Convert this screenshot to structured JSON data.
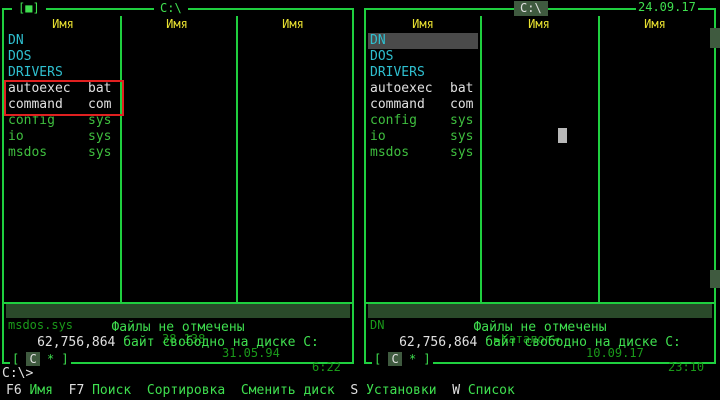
{
  "left_panel": {
    "title": "C:\\",
    "marker": "[■]",
    "col_headers": [
      "Имя",
      "Имя",
      "Имя"
    ],
    "files": [
      {
        "name": "DN",
        "ext": "",
        "kind": "dir"
      },
      {
        "name": "DOS",
        "ext": "",
        "kind": "dir"
      },
      {
        "name": "DRIVERS",
        "ext": "",
        "kind": "dir"
      },
      {
        "name": "autoexec",
        "ext": "bat",
        "kind": "exec"
      },
      {
        "name": "command",
        "ext": "com",
        "kind": "exec"
      },
      {
        "name": "config",
        "ext": "sys",
        "kind": "file"
      },
      {
        "name": "io",
        "ext": "sys",
        "kind": "file"
      },
      {
        "name": "msdos",
        "ext": "sys",
        "kind": "file"
      }
    ],
    "info_name": "msdos.sys",
    "info_size": "38,138",
    "info_date": "31.05.94",
    "info_time": "6:22",
    "status": "Файлы не отмечены",
    "free_bytes": "62,756,864",
    "free_label": "байт свободно на диске C:",
    "drive_prefix": "[",
    "drive_letter": "C",
    "drive_suffix": "* ]"
  },
  "right_panel": {
    "title": "C:\\",
    "clock_date": "24.09.17",
    "col_headers": [
      "Имя",
      "Имя",
      "Имя"
    ],
    "files": [
      {
        "name": "DN",
        "ext": "",
        "kind": "dir"
      },
      {
        "name": "DOS",
        "ext": "",
        "kind": "dir"
      },
      {
        "name": "DRIVERS",
        "ext": "",
        "kind": "dir"
      },
      {
        "name": "autoexec",
        "ext": "bat",
        "kind": "exec"
      },
      {
        "name": "command",
        "ext": "com",
        "kind": "exec"
      },
      {
        "name": "config",
        "ext": "sys",
        "kind": "file"
      },
      {
        "name": "io",
        "ext": "sys",
        "kind": "file"
      },
      {
        "name": "msdos",
        "ext": "sys",
        "kind": "file"
      }
    ],
    "info_name": "DN",
    "info_size": "►Каталог◄",
    "info_date": "10.09.17",
    "info_time": "23:10",
    "status": "Файлы не отмечены",
    "free_bytes": "62,756,864",
    "free_label": "байт свободно на диске C:",
    "drive_prefix": "[",
    "drive_letter": "C",
    "drive_suffix": "* ]"
  },
  "command_line": {
    "prompt": "C:\\>"
  },
  "keybar": [
    {
      "key": "F6",
      "label": "Имя"
    },
    {
      "key": "F7",
      "label": "Поиск"
    },
    {
      "key": "",
      "label": "Сортировка"
    },
    {
      "key": "",
      "label": "Сменить диск"
    },
    {
      "key": "S",
      "label": "Установки"
    },
    {
      "key": "W",
      "label": "Список"
    }
  ],
  "colors": {
    "frame": "#1fcf3f",
    "dir": "#2fc0d0",
    "file": "#3fbf3f",
    "exec": "#e0e0e0",
    "header": "#e8e030",
    "highlight_box": "#e02020"
  }
}
